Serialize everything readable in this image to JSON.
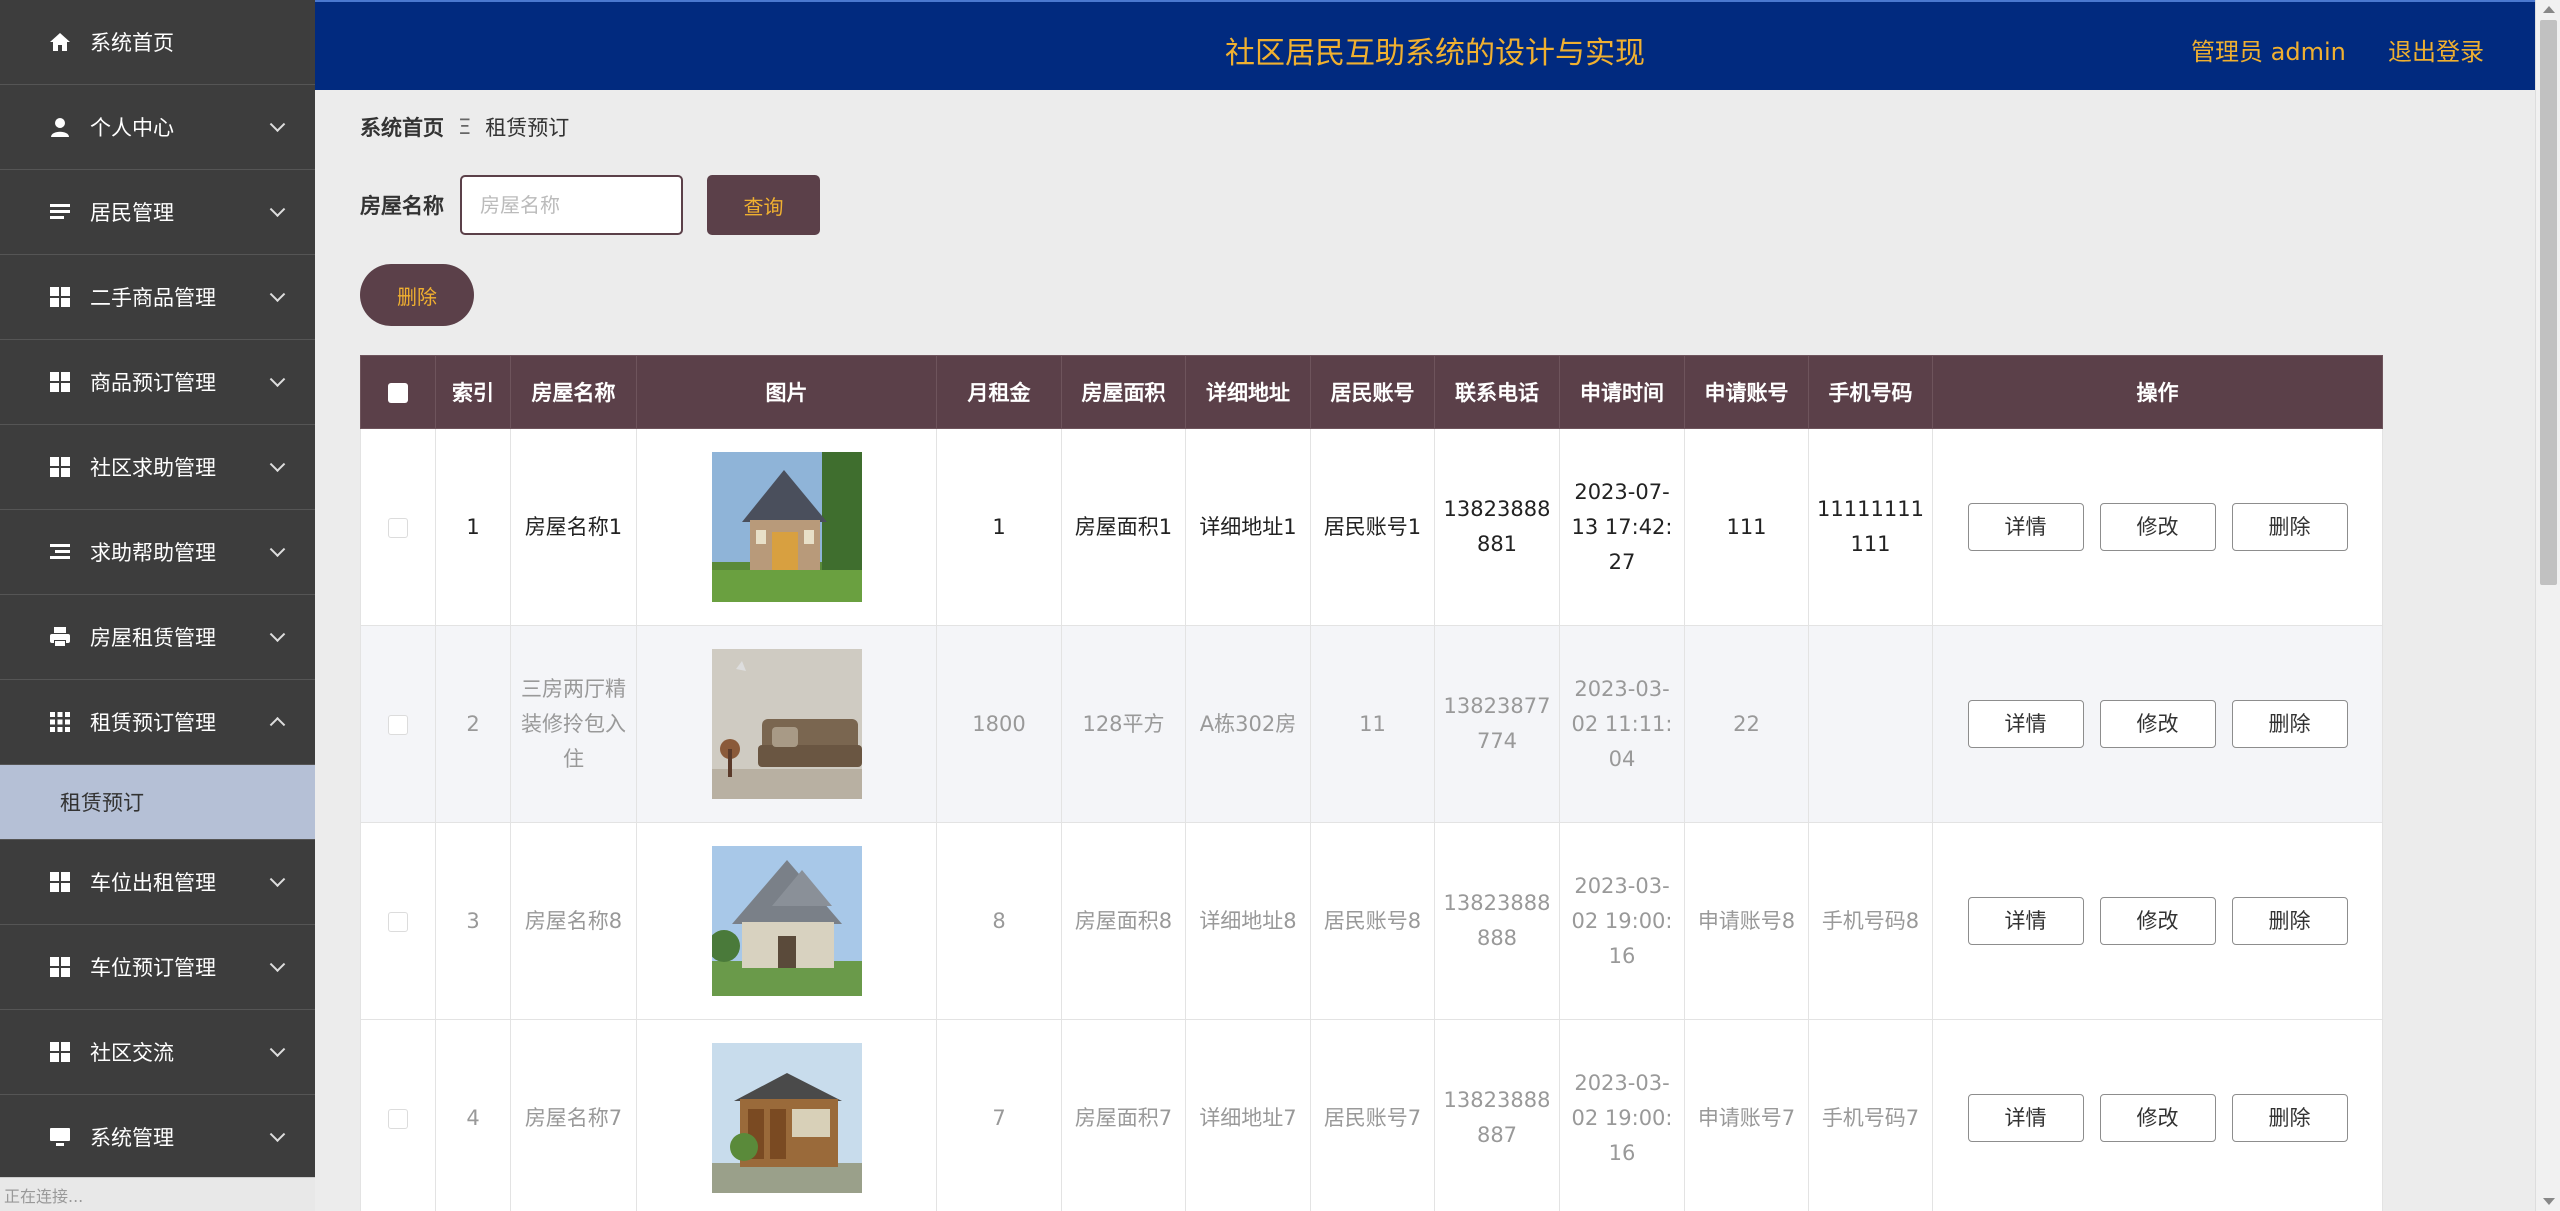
{
  "header": {
    "title": "社区居民互助系统的设计与实现",
    "user": "管理员 admin",
    "logout": "退出登录"
  },
  "sidebar": {
    "items": [
      {
        "label": "系统首页",
        "icon": "home-icon"
      },
      {
        "label": "个人中心",
        "icon": "user-icon"
      },
      {
        "label": "居民管理",
        "icon": "list-icon"
      },
      {
        "label": "二手商品管理",
        "icon": "grid-icon"
      },
      {
        "label": "商品预订管理",
        "icon": "grid-icon"
      },
      {
        "label": "社区求助管理",
        "icon": "grid-icon"
      },
      {
        "label": "求助帮助管理",
        "icon": "list-indent-icon"
      },
      {
        "label": "房屋租赁管理",
        "icon": "printer-icon"
      },
      {
        "label": "租赁预订管理",
        "icon": "apps-icon"
      },
      {
        "label": "车位出租管理",
        "icon": "grid-icon"
      },
      {
        "label": "车位预订管理",
        "icon": "grid-icon"
      },
      {
        "label": "社区交流",
        "icon": "grid-icon"
      },
      {
        "label": "系统管理",
        "icon": "monitor-icon"
      }
    ],
    "submenu": {
      "label": "租赁预订"
    }
  },
  "status_bar": "正在连接...",
  "breadcrumb": {
    "home": "系统首页",
    "separator": "Ξ",
    "current": "租赁预订"
  },
  "search": {
    "label": "房屋名称",
    "placeholder": "房屋名称",
    "button": "查询"
  },
  "delete_button": "删除",
  "table": {
    "headers": [
      "索引",
      "房屋名称",
      "图片",
      "月租金",
      "房屋面积",
      "详细地址",
      "居民账号",
      "联系电话",
      "申请时间",
      "申请账号",
      "手机号码",
      "操作"
    ],
    "actions": {
      "detail": "详情",
      "edit": "修改",
      "delete": "删除"
    },
    "rows": [
      {
        "index": "1",
        "name": "房屋名称1",
        "rent": "1",
        "area": "房屋面积1",
        "address": "详细地址1",
        "resident": "居民账号1",
        "phone": "13823888881",
        "time": "2023-07-13 17:42:27",
        "applicant": "111",
        "mobile": "11111111111"
      },
      {
        "index": "2",
        "name": "三房两厅精装修拎包入住",
        "rent": "1800",
        "area": "128平方",
        "address": "A栋302房",
        "resident": "11",
        "phone": "13823877774",
        "time": "2023-03-02 11:11:04",
        "applicant": "22",
        "mobile": ""
      },
      {
        "index": "3",
        "name": "房屋名称8",
        "rent": "8",
        "area": "房屋面积8",
        "address": "详细地址8",
        "resident": "居民账号8",
        "phone": "13823888888",
        "time": "2023-03-02 19:00:16",
        "applicant": "申请账号8",
        "mobile": "手机号码8"
      },
      {
        "index": "4",
        "name": "房屋名称7",
        "rent": "7",
        "area": "房屋面积7",
        "address": "详细地址7",
        "resident": "居民账号7",
        "phone": "13823888887",
        "time": "2023-03-02 19:00:16",
        "applicant": "申请账号7",
        "mobile": "手机号码7"
      }
    ]
  }
}
